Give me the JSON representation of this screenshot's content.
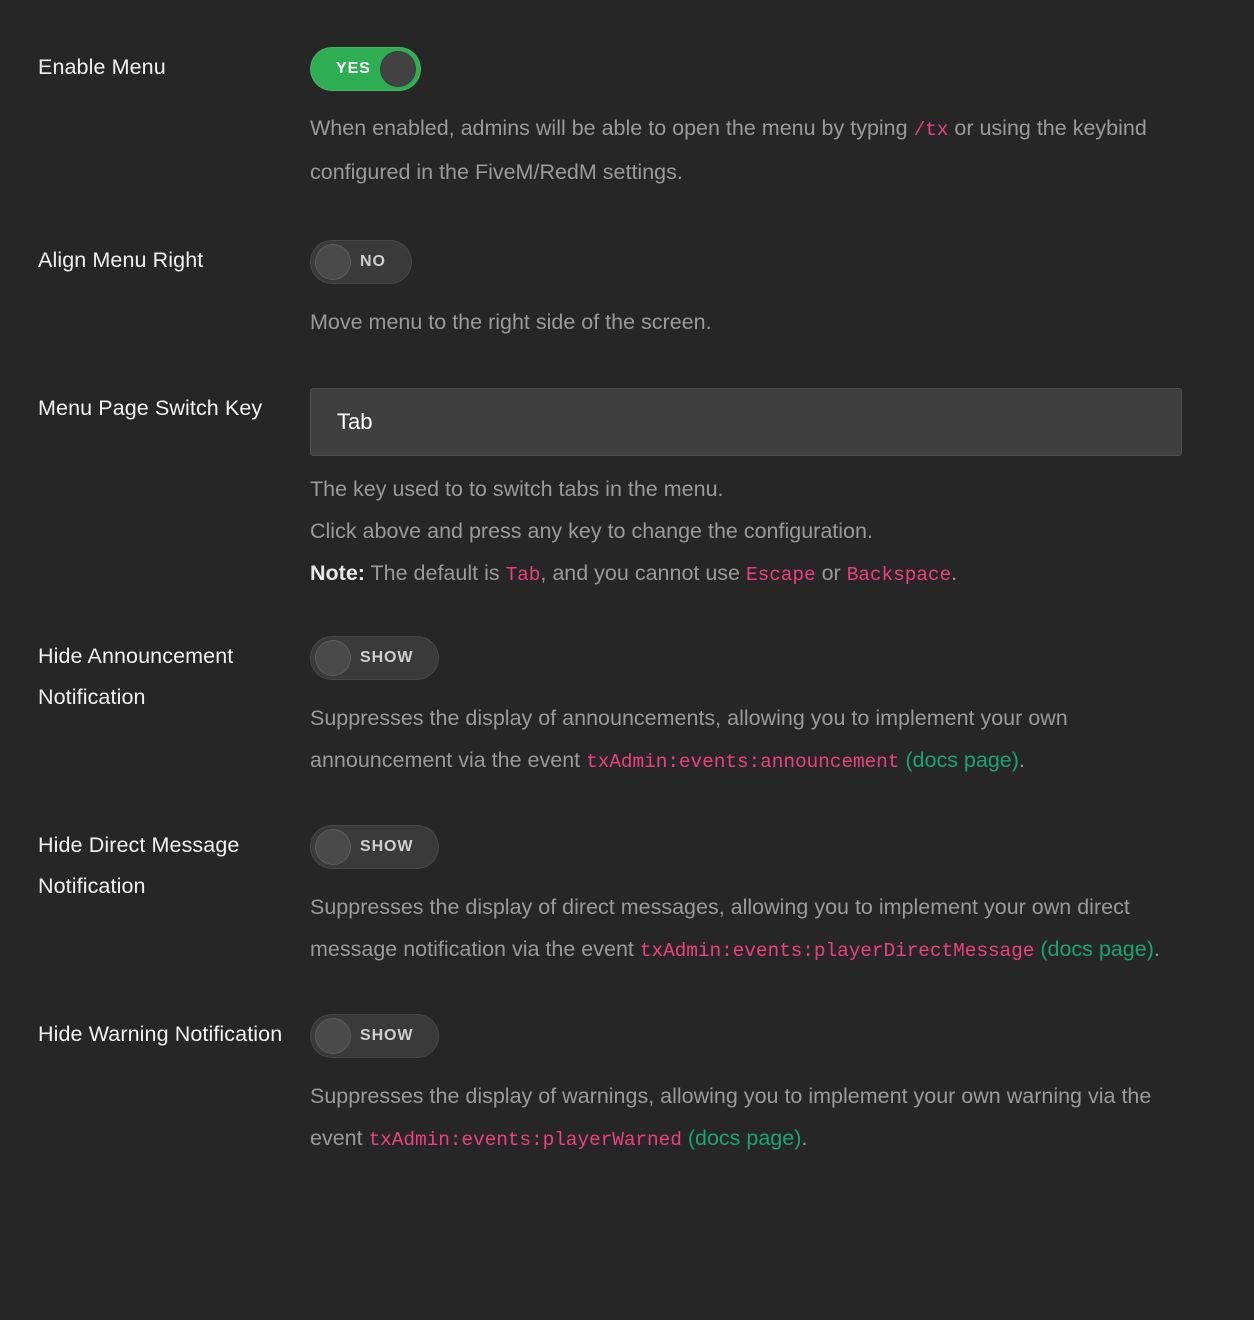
{
  "settings": {
    "enable_menu": {
      "label": "Enable Menu",
      "toggle": {
        "state": "on",
        "text": "YES"
      },
      "description_parts": [
        {
          "type": "text",
          "value": "When enabled, admins will be able to open the menu by typing "
        },
        {
          "type": "code",
          "value": "/tx"
        },
        {
          "type": "text",
          "value": " or using the keybind configured in the FiveM/RedM settings."
        }
      ],
      "desc_line1_a": "When enabled, admins will be able to open the menu by typing ",
      "desc_code1": "/tx",
      "desc_line1_b": " or using the keybind configured in the FiveM/RedM settings."
    },
    "align_menu_right": {
      "label": "Align Menu Right",
      "toggle": {
        "state": "off",
        "text": "NO"
      },
      "description": "Move menu to the right side of the screen."
    },
    "menu_page_switch_key": {
      "label": "Menu Page Switch Key",
      "input_value": "Tab",
      "input_placeholder": "Tab",
      "desc_line1": "The key used to to switch tabs in the menu.",
      "desc_line2": "Click above and press any key to change the configuration.",
      "note_label": "Note:",
      "note_text_1": " The default is ",
      "note_code_1": "Tab",
      "note_text_2": ", and you cannot use ",
      "note_code_2": "Escape",
      "note_text_3": " or ",
      "note_code_3": "Backspace",
      "note_text_4": "."
    },
    "hide_announcement": {
      "label": "Hide Announcement Notification",
      "toggle": {
        "state": "off",
        "text": "SHOW"
      },
      "desc_text_1": "Suppresses the display of announcements, allowing you to implement your own announcement via the event ",
      "desc_code": "txAdmin:events:announcement",
      "desc_text_2": " ",
      "docs_open": "(",
      "docs_link": "docs page",
      "docs_close": ")",
      "desc_period": "."
    },
    "hide_direct_message": {
      "label": "Hide Direct Message Notification",
      "toggle": {
        "state": "off",
        "text": "SHOW"
      },
      "desc_text_1": "Suppresses the display of direct messages, allowing you to implement your own direct message notification via the event ",
      "desc_code": "txAdmin:events:playerDirectMessage",
      "desc_text_2": " ",
      "docs_open": "(",
      "docs_link": "docs page",
      "docs_close": ")",
      "desc_period": "."
    },
    "hide_warning": {
      "label": "Hide Warning Notification",
      "toggle": {
        "state": "off",
        "text": "SHOW"
      },
      "desc_text_1": "Suppresses the display of warnings, allowing you to implement your own warning via the event ",
      "desc_code": "txAdmin:events:playerWarned",
      "desc_text_2": " ",
      "docs_open": "(",
      "docs_link": "docs page",
      "docs_close": ")",
      "desc_period": "."
    }
  },
  "colors": {
    "background": "#262626",
    "label_text": "#f2f2f2",
    "description_text": "#9a9a9a",
    "code_accent": "#ec3f82",
    "link_accent": "#17a673",
    "toggle_on": "#2fad53",
    "toggle_off": "#3a3a3a",
    "input_background": "#3f3f3f"
  }
}
